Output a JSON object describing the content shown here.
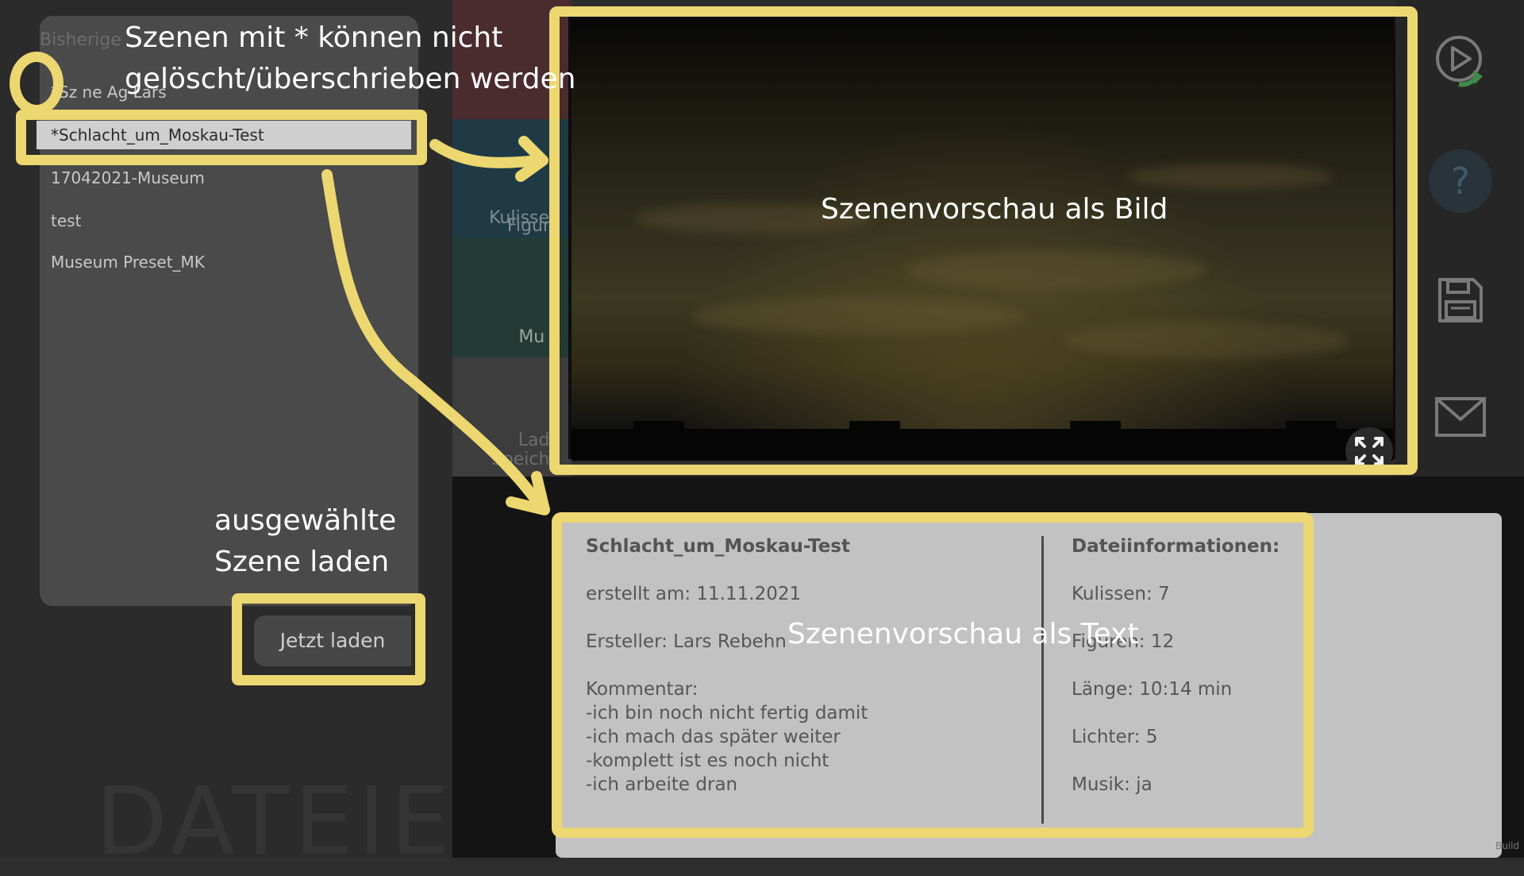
{
  "file_panel": {
    "title": "Bisherige",
    "scenes": [
      "*Sz     ne Ag   Lars",
      "*Schlacht_um_Moskau-Test",
      "17042021-Museum",
      "test",
      "Museum Preset_MK"
    ],
    "selected_index": 1,
    "watermark": "DATEIEN"
  },
  "load_button": {
    "label": "Jetzt laden"
  },
  "categories": {
    "kulissen": "Kulissen",
    "figuren": "Figure",
    "musik": "Mu  k",
    "laden_line1": "Lade",
    "laden_line2": "Speiche"
  },
  "info": {
    "scene_name": "Schlacht_um_Moskau-Test",
    "created": "erstellt am: 11.11.2021",
    "author": "Ersteller: Lars Rebehn",
    "comment_label": "Kommentar:",
    "comment_lines": [
      "-ich bin noch nicht fertig damit",
      "-ich mach das später weiter",
      "-komplett ist es noch nicht",
      "-ich arbeite dran"
    ],
    "file_info_title": "Dateiinformationen:",
    "kulissen": "Kulissen: 7",
    "figuren": "Figuren: 12",
    "laenge": "Länge: 10:14 min",
    "lichter": "Lichter: 5",
    "musik": "Musik: ja"
  },
  "annotations": {
    "asterisk_note_line1": "Szenen mit * können nicht",
    "asterisk_note_line2": "gelöscht/überschrieben werden",
    "load_note_line1": "ausgewählte",
    "load_note_line2": "Szene laden",
    "preview_image_note": "Szenenvorschau als Bild",
    "preview_text_note": "Szenenvorschau als Text",
    "color": "#ecd770"
  },
  "toolbar": {
    "icons": [
      "play-icon",
      "help-icon",
      "save-icon",
      "mail-icon"
    ]
  },
  "build_label": "Build"
}
